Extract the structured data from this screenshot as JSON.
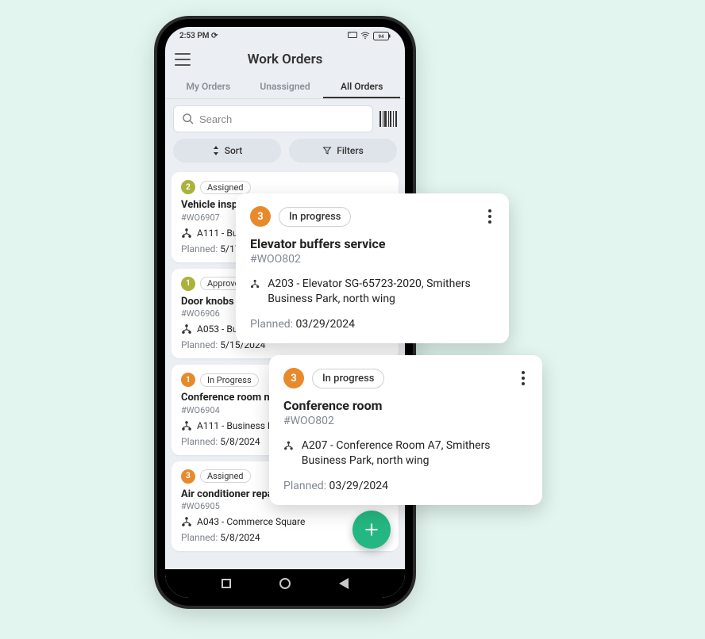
{
  "status_bar": {
    "time": "2:53 PM ⟳",
    "battery": "94"
  },
  "header": {
    "title": "Work Orders"
  },
  "tabs": [
    "My Orders",
    "Unassigned",
    "All Orders"
  ],
  "active_tab": 2,
  "search": {
    "placeholder": "Search"
  },
  "sort_label": "Sort",
  "filters_label": "Filters",
  "cards": [
    {
      "num": "2",
      "num_color": "olive",
      "status": "Assigned",
      "title": "Vehicle inspect",
      "id": "#WO6907",
      "location": "A111 - Busin",
      "planned_label": "Planned:",
      "planned": "5/17/"
    },
    {
      "num": "1",
      "num_color": "olive",
      "status": "Approved",
      "title": "Door knobs sw",
      "id": "#WO6906",
      "location": "A053 - Busin",
      "planned_label": "Planned:",
      "planned": "5/15/2024"
    },
    {
      "num": "1",
      "num_color": "orange",
      "status": "In Progress",
      "title": "Conference room main",
      "id": "#WO6904",
      "location": "A111 - Business Par",
      "planned_label": "Planned:",
      "planned": "5/8/2024"
    },
    {
      "num": "3",
      "num_color": "orange",
      "status": "Assigned",
      "title": "Air conditioner repair",
      "id": "#WO6905",
      "location": "A043 - Commerce Square",
      "planned_label": "Planned:",
      "planned": "5/8/2024"
    }
  ],
  "overlays": [
    {
      "num": "3",
      "status": "In progress",
      "title": "Elevator buffers service",
      "id": "#WOO802",
      "location": "A203 - Elevator SG-65723-2020, Smithers Business Park, north wing",
      "planned_label": "Planned:",
      "planned": "03/29/2024"
    },
    {
      "num": "3",
      "status": "In progress",
      "title": "Conference room",
      "id": "#WOO802",
      "location": "A207 - Conference Room A7, Smithers Business Park, north wing",
      "planned_label": "Planned:",
      "planned": "03/29/2024"
    }
  ]
}
